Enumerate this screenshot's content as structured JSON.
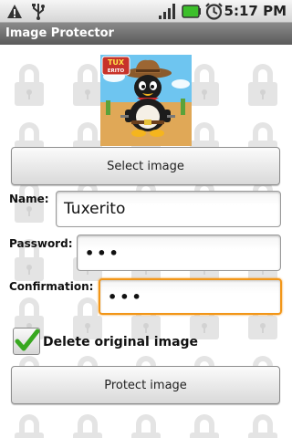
{
  "status_bar": {
    "time": "5:17 PM",
    "icons": [
      "warning-icon",
      "usb-icon",
      "signal-icon",
      "battery-icon",
      "alarm-icon"
    ],
    "battery_color": "#3cbf2a"
  },
  "app": {
    "title": "Image Protector"
  },
  "form": {
    "select_image_label": "Select image",
    "name_label": "Name:",
    "name_value": "Tuxerito",
    "password_label": "Password:",
    "password_value": "•••",
    "confirmation_label": "Confirmation:",
    "confirmation_value": "•••",
    "delete_original_label": "Delete original image",
    "delete_original_checked": true,
    "protect_label": "Protect image"
  },
  "image": {
    "logo_text_top": "TUX",
    "logo_text_bottom": "ERITO"
  },
  "colors": {
    "focus": "#f29618",
    "check": "#38a820"
  }
}
